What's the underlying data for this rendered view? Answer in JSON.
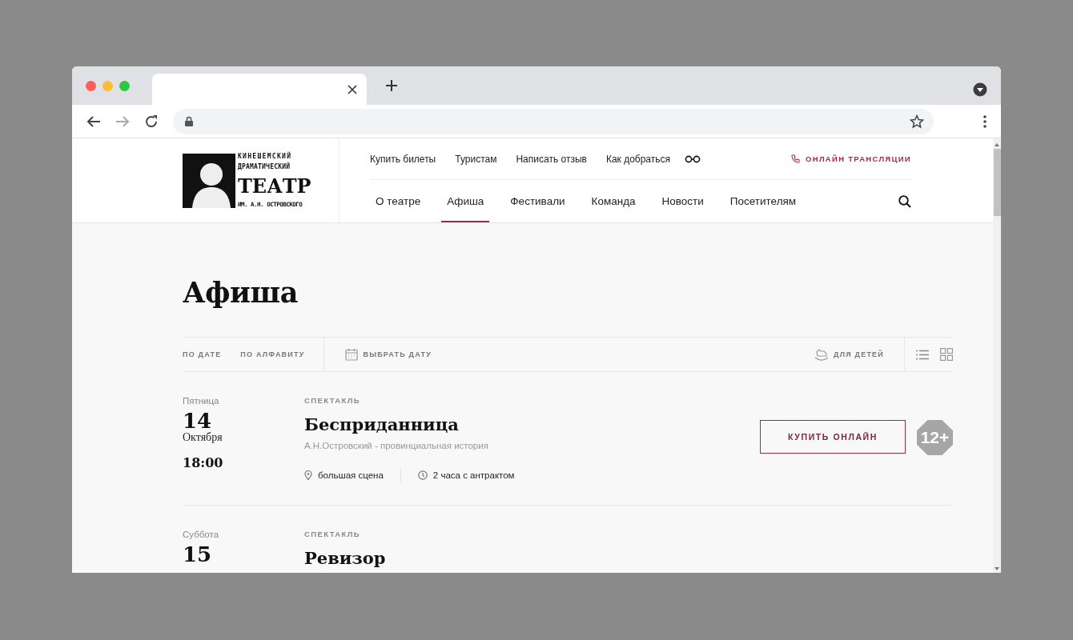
{
  "logo": {
    "lines": [
      "КИНЕШЕМСКИЙ",
      "ДРАМАТИЧЕСКИЙ",
      "ТЕАТР",
      "ИМ. А.Н. ОСТРОВСКОГО"
    ]
  },
  "top_links": [
    "Купить билеты",
    "Туристам",
    "Написать отзыв",
    "Как добраться"
  ],
  "broadcast_link": "ОНЛАЙН ТРАНСЛЯЦИИ",
  "nav": [
    {
      "label": "О театре",
      "selected": false
    },
    {
      "label": "Афиша",
      "selected": true
    },
    {
      "label": "Фестивали",
      "selected": false
    },
    {
      "label": "Команда",
      "selected": false
    },
    {
      "label": "Новости",
      "selected": false
    },
    {
      "label": "Посетителям",
      "selected": false
    }
  ],
  "page_title": "Афиша",
  "filters": {
    "sort": [
      "ПО ДАТЕ",
      "ПО АЛФАВИТУ"
    ],
    "date_picker": "ВЫБРАТЬ ДАТУ",
    "kids": "ДЛЯ ДЕТЕЙ"
  },
  "events": [
    {
      "weekday": "Пятница",
      "day": "14",
      "month": "Октября",
      "time": "18:00",
      "type": "СПЕКТАКЛЬ",
      "title": "Бесприданница",
      "subtitle": "А.Н.Островский - провинциальная история",
      "venue": "большая сцена",
      "duration": "2 часа с антрактом",
      "button": "КУПИТЬ ОНЛАЙН",
      "age": "12+"
    },
    {
      "weekday": "Суббота",
      "day": "15",
      "type": "СПЕКТАКЛЬ",
      "title": "Ревизор"
    }
  ]
}
